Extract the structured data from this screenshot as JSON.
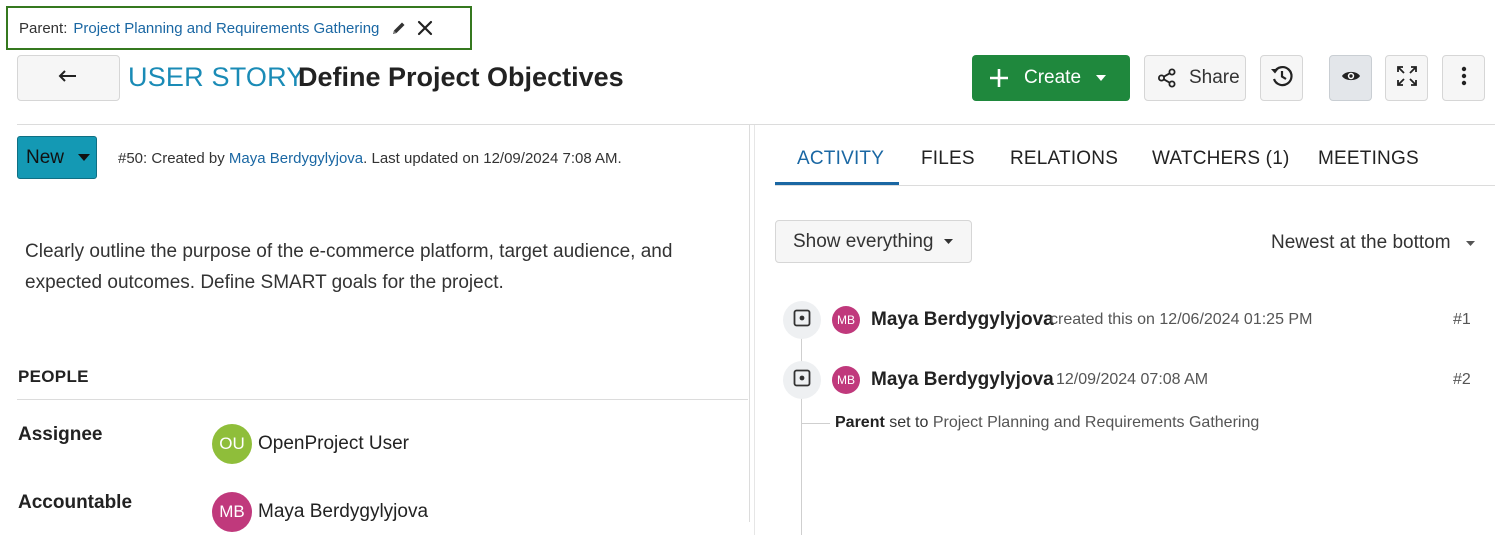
{
  "parent": {
    "label": "Parent:",
    "link": "Project Planning and Requirements Gathering"
  },
  "header": {
    "type": "USER STORY",
    "subject": "Define Project Objectives",
    "create_label": "Create",
    "share_label": "Share"
  },
  "status": {
    "label": "New",
    "color": "#1499b4"
  },
  "meta": {
    "prefix": "#50: Created by ",
    "author": "Maya Berdygylyjova",
    "suffix": ". Last updated on 12/09/2024 7:08 AM."
  },
  "description": "Clearly outline the purpose of the e-commerce platform, target audience, and expected outcomes. Define SMART goals for the project.",
  "people": {
    "title": "PEOPLE",
    "assignee": {
      "label": "Assignee",
      "initials": "OU",
      "name": "OpenProject User",
      "color": "#8fbe3a"
    },
    "accountable": {
      "label": "Accountable",
      "initials": "MB",
      "name": "Maya Berdygylyjova",
      "color": "#c0397c"
    }
  },
  "tabs": [
    {
      "label": "ACTIVITY",
      "active": true
    },
    {
      "label": "FILES"
    },
    {
      "label": "RELATIONS"
    },
    {
      "label": "WATCHERS (1)"
    },
    {
      "label": "MEETINGS"
    }
  ],
  "activity": {
    "filter_label": "Show everything",
    "sort_label": "Newest at the bottom",
    "entries": [
      {
        "initials": "MB",
        "name": "Maya Berdygylyjova",
        "text": "created this on 12/06/2024 01:25 PM",
        "num": "#1"
      },
      {
        "initials": "MB",
        "name": "Maya Berdygylyjova",
        "text": "12/09/2024 07:08 AM",
        "num": "#2",
        "change": {
          "field": "Parent",
          "verb": " set to ",
          "value": "Project Planning and Requirements Gathering"
        }
      }
    ]
  },
  "colors": {
    "accent": "#1a67a3",
    "create": "#1f883d",
    "parent_border": "#35781f"
  }
}
